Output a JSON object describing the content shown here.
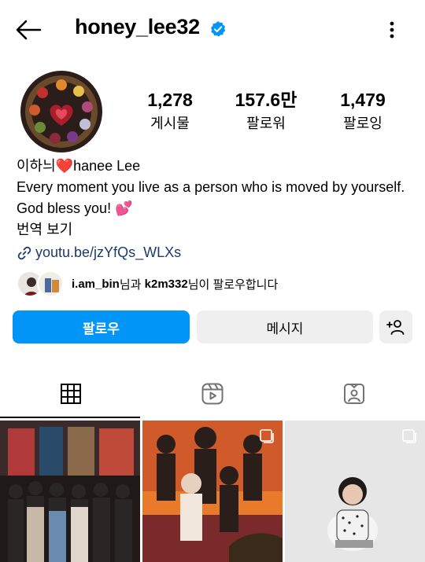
{
  "header": {
    "username": "honey_lee32",
    "back_icon": "arrow-left-icon",
    "verified_icon": "verified-badge-icon",
    "more_icon": "more-vertical-icon"
  },
  "stats": {
    "posts": {
      "value": "1,278",
      "label": "게시물"
    },
    "followers": {
      "value": "157.6만",
      "label": "팔로워"
    },
    "following": {
      "value": "1,479",
      "label": "팔로잉"
    }
  },
  "bio": {
    "name": "이하늬❤️hanee Lee",
    "text": "Every moment you live as a person who is moved by yourself. God bless you! 💕",
    "translate": "번역 보기",
    "link": "youtu.be/jzYfQs_WLXs"
  },
  "followed_by": {
    "user1": "i.am_bin",
    "connector": "님과 ",
    "user2": "k2m332",
    "suffix": "님이 팔로우합니다"
  },
  "actions": {
    "follow": "팔로우",
    "message": "메시지",
    "add_user_icon": "add-person-icon"
  },
  "tabs": [
    {
      "icon": "grid-icon",
      "active": true
    },
    {
      "icon": "reels-icon",
      "active": false
    },
    {
      "icon": "tagged-icon",
      "active": false
    }
  ],
  "colors": {
    "accent": "#0095f6",
    "secondary_button": "#efefef",
    "link": "#1e3a6e"
  }
}
